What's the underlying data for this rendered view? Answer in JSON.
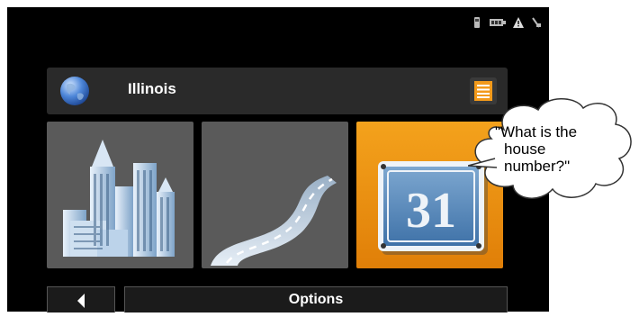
{
  "location": {
    "name": "Illinois"
  },
  "tiles": [
    {
      "name": "city",
      "icon": "city-icon"
    },
    {
      "name": "street",
      "icon": "road-icon"
    },
    {
      "name": "house-number",
      "icon": "house-number-sign-icon",
      "sign_value": "31"
    }
  ],
  "bottom": {
    "options_label": "Options",
    "back_icon": "back-arrow-icon"
  },
  "status_icons": [
    "phone-icon",
    "battery-icon",
    "warning-icon",
    "gps-icon"
  ],
  "callout": {
    "line1": "\"What is the",
    "line2": "house",
    "line3": "number?\""
  },
  "colors": {
    "active_tile": "#f39a1a",
    "tile": "#5a5a5a",
    "screen_bg": "#000000"
  }
}
